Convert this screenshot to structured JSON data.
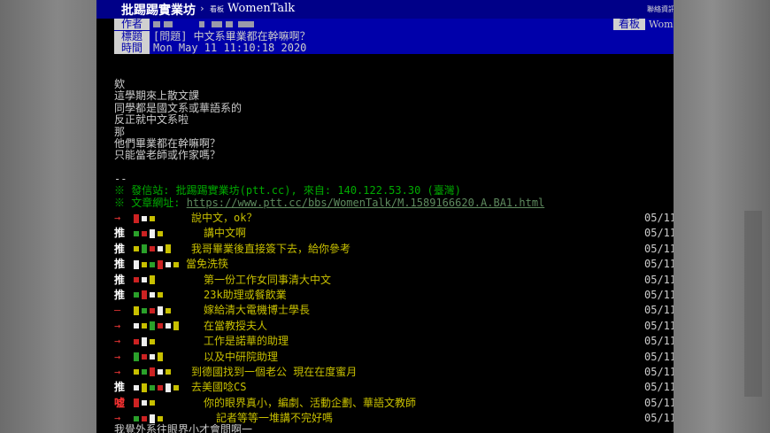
{
  "topbar": {
    "board_name": "批踢踢實業坊",
    "separator": "›",
    "tag": "看板",
    "board_id": "WomenTalk",
    "right_text": "聯絡資訊"
  },
  "header": {
    "author_label": "作者",
    "title_label": "標題",
    "time_label": "時間",
    "board_label": "看板",
    "board_value": "Women",
    "title": "[問題] 中文系畢業都在幹嘛啊？",
    "time": "Mon May 11 11:10:18 2020"
  },
  "body": {
    "lines": [
      "欸",
      "這學期來上散文課",
      "同學都是國文系或華語系的",
      "反正就中文系啦",
      "那",
      "他們畢業都在幹嘛啊？",
      "只能當老師或作家嗎？"
    ]
  },
  "signature": {
    "dashes": "--",
    "source": "※ 發信站: 批踢踢實業坊(ptt.cc), 來自: 140.122.53.30 (臺灣)",
    "url_prefix": "※ 文章網址: ",
    "url": "https://www.ptt.cc/bbs/WomenTalk/M.1589166620.A.BA1.html"
  },
  "colors": {
    "push_text": "#c8c000",
    "arrow": "#dd3333",
    "header_bg": "#0000aa"
  },
  "pushes": [
    {
      "tag": "→",
      "kind": "arrow",
      "text": "說中文，ok？",
      "date": "05/11"
    },
    {
      "tag": "推",
      "kind": "push",
      "text": "講中文啊",
      "date": "05/11"
    },
    {
      "tag": "推",
      "kind": "push",
      "text": "我哥畢業後直接簽下去，給你參考",
      "date": "05/11"
    },
    {
      "tag": "推",
      "kind": "push",
      "text": "當免洗筷",
      "date": "05/11"
    },
    {
      "tag": "推",
      "kind": "push",
      "text": "第一份工作女同事清大中文",
      "date": "05/11"
    },
    {
      "tag": "推",
      "kind": "push",
      "text": "23k助理或餐飲業",
      "date": "05/11"
    },
    {
      "tag": "–",
      "kind": "arrow",
      "text": "嫁給清大電機博士學長",
      "date": "05/11"
    },
    {
      "tag": "→",
      "kind": "arrow",
      "text": "在當教授夫人",
      "date": "05/11"
    },
    {
      "tag": "→",
      "kind": "arrow",
      "text": "工作是諾華的助理",
      "date": "05/11"
    },
    {
      "tag": "→",
      "kind": "arrow",
      "text": "以及中研院助理",
      "date": "05/11"
    },
    {
      "tag": "→",
      "kind": "arrow",
      "text": "到德國找到一個老公 現在在度蜜月",
      "date": "05/11"
    },
    {
      "tag": "推",
      "kind": "push",
      "text": "去美國唸CS",
      "date": "05/11"
    },
    {
      "tag": "噓",
      "kind": "boo",
      "text": "你的眼界真小，編劇、活動企劃、華語文教師",
      "date": "05/11"
    },
    {
      "tag": "→",
      "kind": "arrow",
      "text": "記者等等一堆講不完好嗎",
      "date": "05/11"
    }
  ],
  "bottom": {
    "partial_line": "我覺外系往眼界小才會問啊一"
  }
}
